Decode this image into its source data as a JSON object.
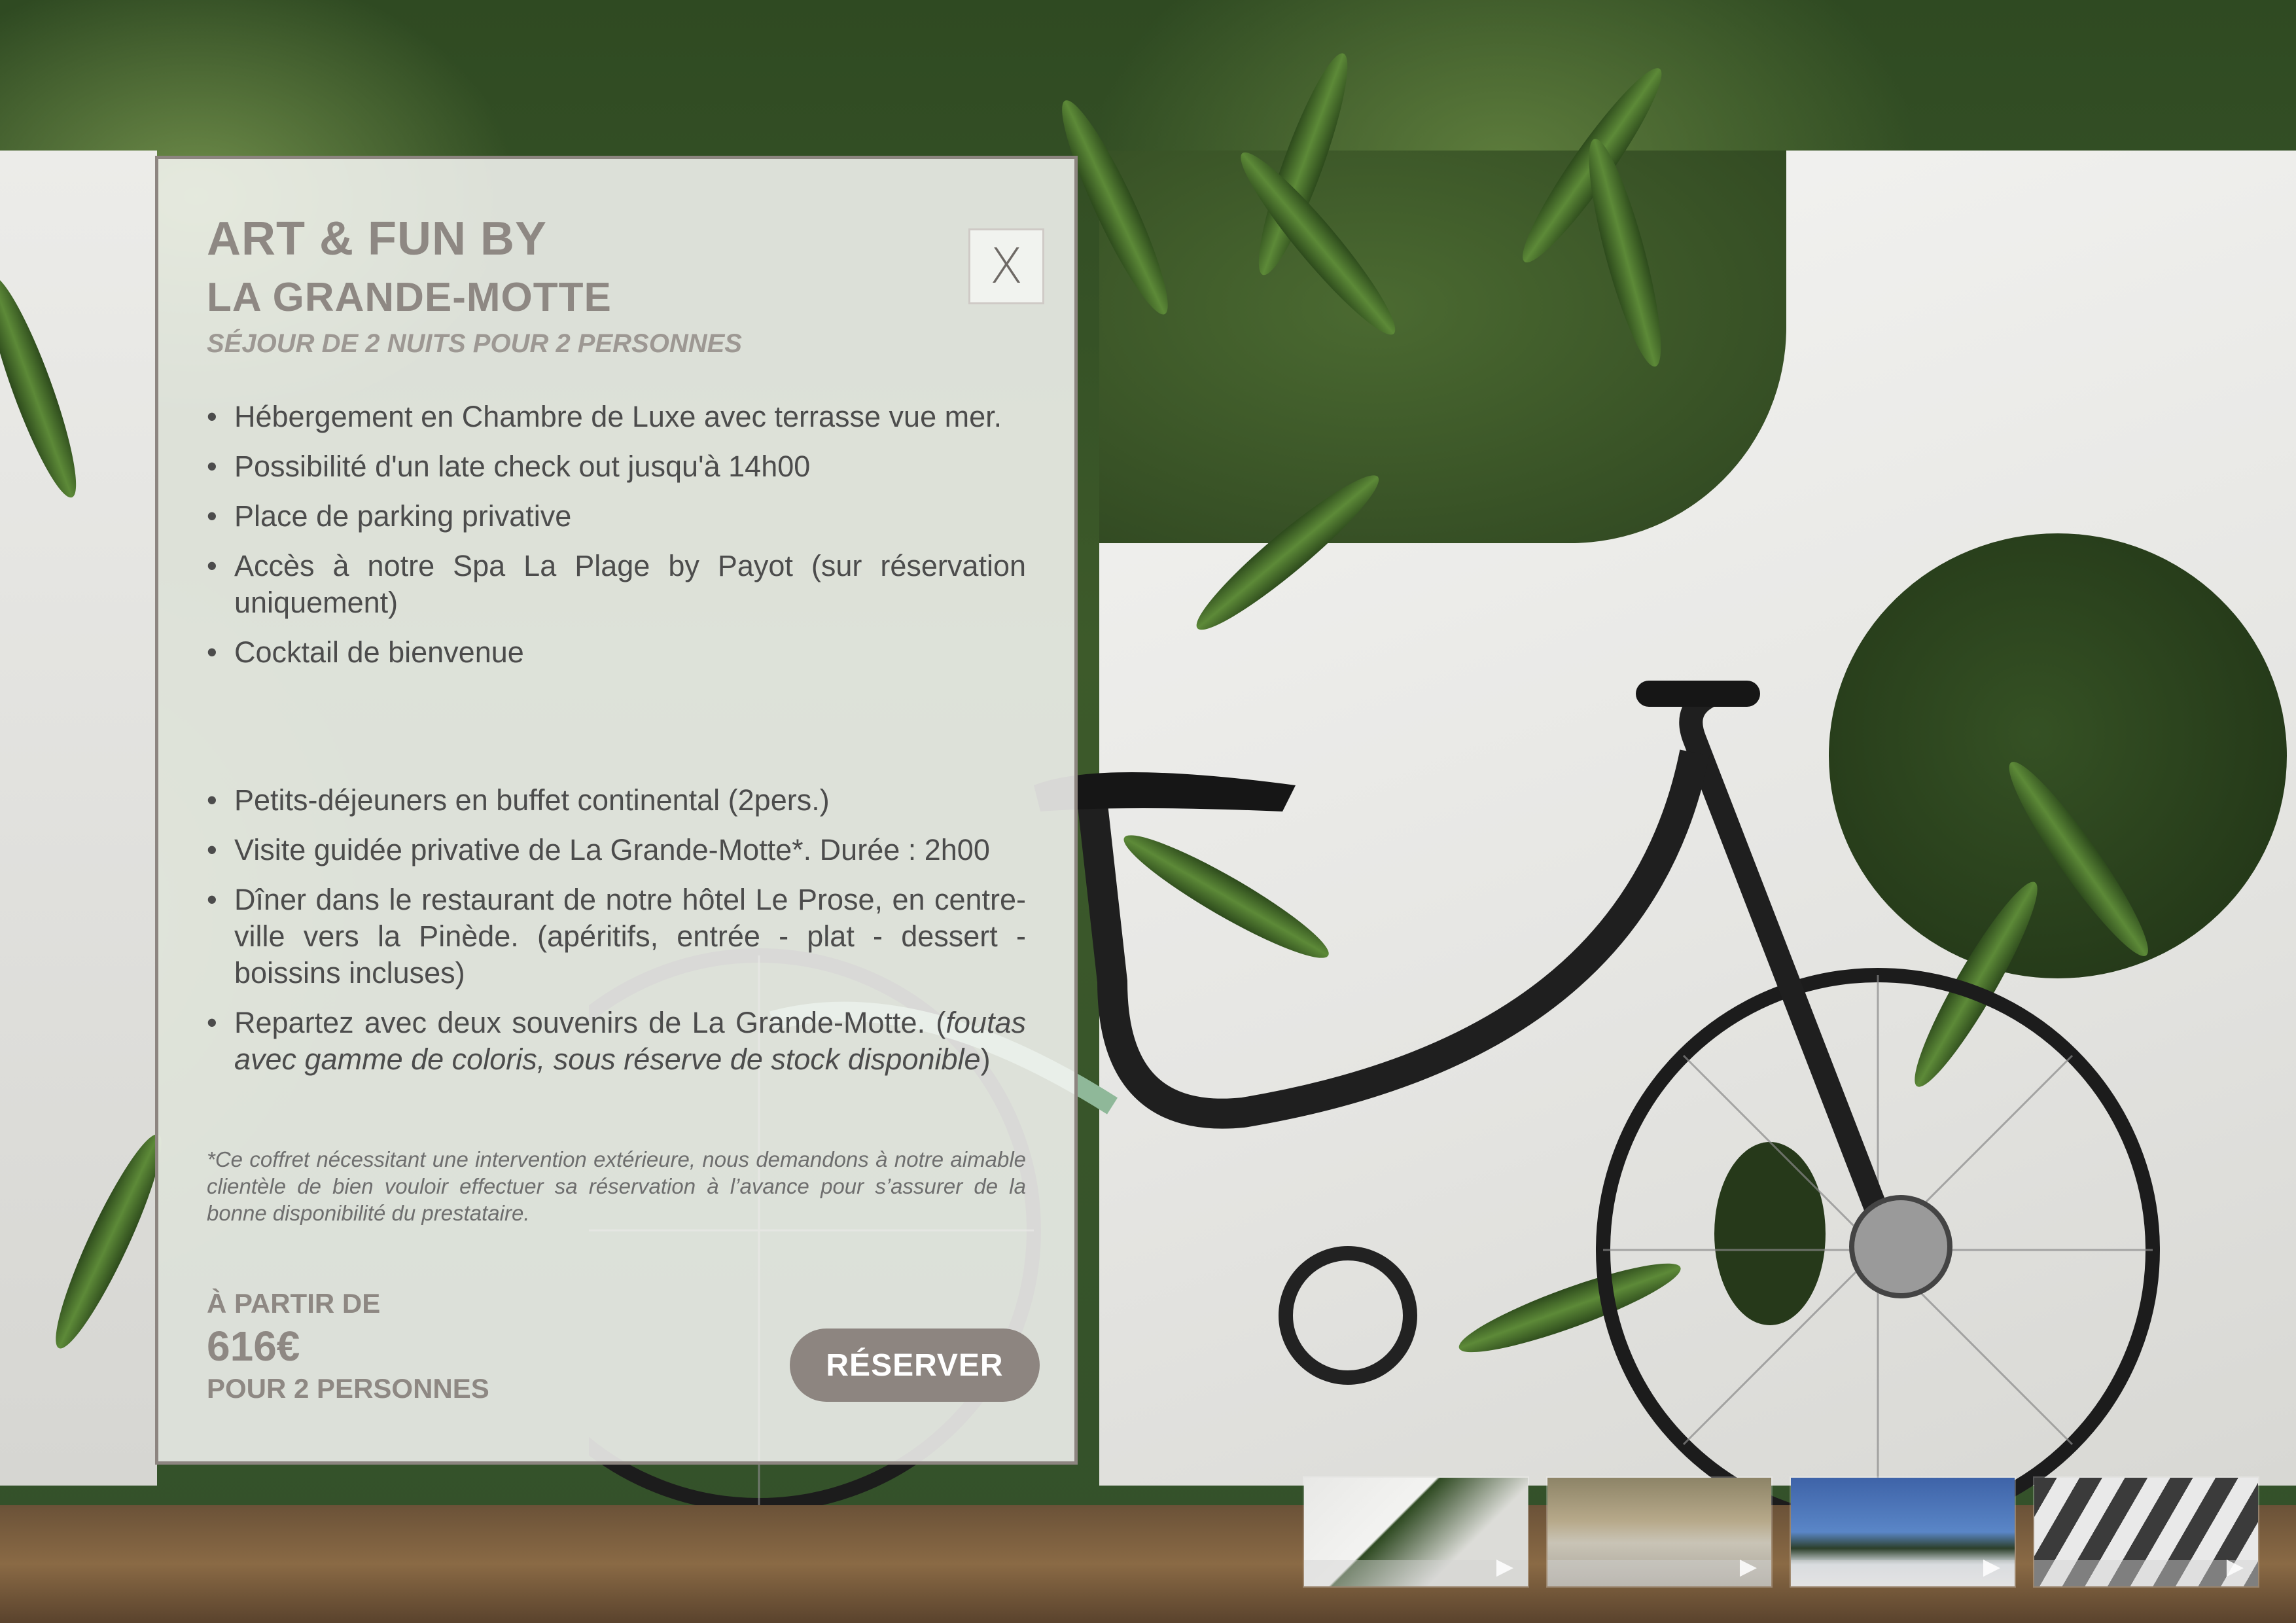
{
  "offer": {
    "title_line1": "ART & FUN BY",
    "title_line2": "LA GRANDE-MOTTE",
    "subtitle": "SÉJOUR DE 2 NUITS POUR 2 PERSONNES",
    "close_label": "X",
    "features": [
      "Hébergement en Chambre de Luxe avec terrasse vue mer.",
      "Possibilité d'un late check out  jusqu'à 14h00",
      "Place de parking privative",
      "Accès à notre Spa La Plage by Payot (sur réservation uniquement)",
      "Cocktail de bienvenue",
      "Petits-déjeuners en buffet continental (2pers.)",
      "Visite guidée privative de La Grande-Motte*. Durée : 2h00",
      "Dîner dans le restaurant de notre hôtel Le Prose, en centre-ville vers la Pinède. (apéritifs, entrée - plat - dessert - boissins incluses)"
    ],
    "last_feature_text": "Repartez avec deux souvenirs de La Grande-Motte. (",
    "last_feature_italic": "foutas avec gamme de coloris, sous réserve de stock disponible",
    "last_feature_end": ")",
    "footnote": "*Ce coffret nécessitant une intervention extérieure, nous demandons à notre aimable clientèle de bien vouloir effectuer sa réservation à l’avance pour s’assurer de la bonne disponibilité du prestataire.",
    "from_label": "À PARTIR DE",
    "price": "616€",
    "per_label": "POUR 2 PERSONNES",
    "reserve_label": "RÉSERVER"
  },
  "thumbnails": [
    {
      "name": "bike-wall",
      "icon": "play-icon"
    },
    {
      "name": "reeds",
      "icon": "play-icon"
    },
    {
      "name": "palm-beach",
      "icon": "play-icon"
    },
    {
      "name": "architecture",
      "icon": "play-icon"
    }
  ],
  "colors": {
    "accent": "#8d8580",
    "panel_bg": "#f8f8f6",
    "text": "#4c4c4c",
    "heading": "#8e8883"
  }
}
